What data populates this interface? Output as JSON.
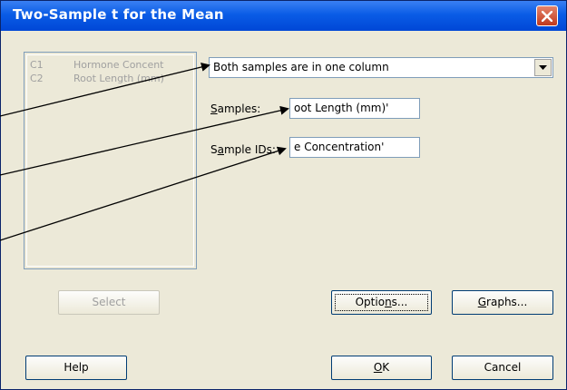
{
  "window": {
    "title": "Two-Sample t for the Mean"
  },
  "columns": [
    {
      "id": "C1",
      "name": "Hormone Concent"
    },
    {
      "id": "C2",
      "name": "Root Length (mm)"
    }
  ],
  "combo": {
    "value": "Both samples are in one column"
  },
  "samples": {
    "label_prefix": "",
    "label_accel": "S",
    "label_rest": "amples:",
    "value": "oot Length (mm)'"
  },
  "sample_ids": {
    "label_prefix": "S",
    "label_accel": "a",
    "label_rest": "mple IDs:",
    "value": "e Concentration'"
  },
  "buttons": {
    "select": "Select",
    "options_prefix": "Optio",
    "options_accel": "n",
    "options_rest": "s...",
    "graphs_accel": "G",
    "graphs_rest": "raphs...",
    "help": "Help",
    "ok_accel": "O",
    "ok_rest": "K",
    "cancel": "Cancel"
  },
  "icons": {
    "close": "close-icon",
    "dropdown": "chevron-down-icon"
  },
  "colors": {
    "titlebar": "#0a5ce6",
    "close": "#d2462a",
    "face": "#ece9d8",
    "field_border": "#7f9db9"
  }
}
